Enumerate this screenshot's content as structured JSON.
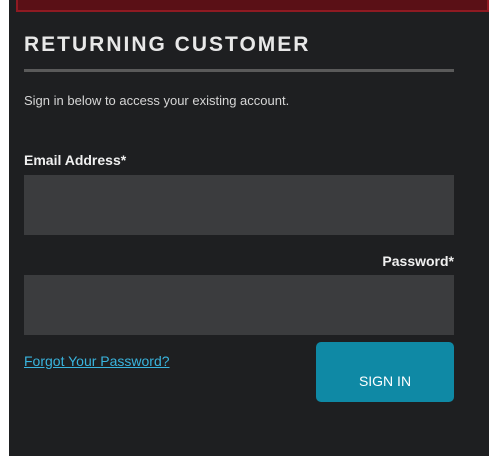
{
  "login": {
    "heading": "RETURNING CUSTOMER",
    "intro": "Sign in below to access your existing account.",
    "email_label": "Email Address*",
    "email_value": "",
    "password_label": "Password*",
    "password_value": "",
    "forgot_link": "Forgot Your Password?",
    "signin_label": "SIGN IN"
  },
  "colors": {
    "panel_background": "#1e1f21",
    "field_background": "#3b3c3e",
    "accent_red": "#8f1a22",
    "link": "#39b4de",
    "button": "#0f89a5"
  }
}
